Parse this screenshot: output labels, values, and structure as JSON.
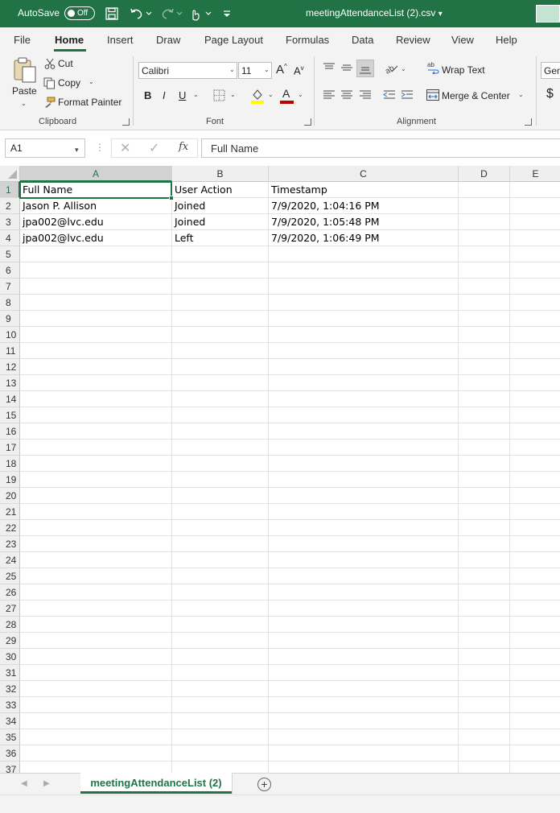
{
  "titlebar": {
    "autosave_label": "AutoSave",
    "autosave_state": "Off",
    "document_title": "meetingAttendanceList (2).csv",
    "title_chevron": "⌄",
    "icons": [
      "save-icon",
      "undo-icon",
      "redo-icon",
      "touch-mode-icon",
      "customize-qat-icon"
    ]
  },
  "ribbon_tabs": [
    "File",
    "Home",
    "Insert",
    "Draw",
    "Page Layout",
    "Formulas",
    "Data",
    "Review",
    "View",
    "Help"
  ],
  "active_tab": "Home",
  "clipboard": {
    "paste_label": "Paste",
    "cut_label": "Cut",
    "copy_label": "Copy",
    "format_painter_label": "Format Painter",
    "group_label": "Clipboard"
  },
  "font": {
    "font_name": "Calibri",
    "font_size": "11",
    "increase_label": "A",
    "decrease_label": "A",
    "bold_label": "B",
    "italic_label": "I",
    "underline_label": "U",
    "font_color_label": "A",
    "group_label": "Font"
  },
  "alignment": {
    "wrap_text_label": "Wrap Text",
    "merge_center_label": "Merge & Center",
    "group_label": "Alignment"
  },
  "number": {
    "format_partial": "Gen",
    "currency_symbol": "$"
  },
  "formula_bar": {
    "name_box": "A1",
    "fx_label": "fx",
    "formula": "Full Name"
  },
  "grid": {
    "columns": [
      "A",
      "B",
      "C",
      "D",
      "E"
    ],
    "row_numbers": [
      "1",
      "2",
      "3",
      "4",
      "5",
      "6",
      "7",
      "8",
      "9",
      "10",
      "11",
      "12",
      "13",
      "14",
      "15",
      "16",
      "17",
      "18",
      "19",
      "20",
      "21",
      "22",
      "23",
      "24",
      "25",
      "26",
      "27",
      "28",
      "29",
      "30",
      "31",
      "32",
      "33",
      "34",
      "35",
      "36",
      "37"
    ],
    "rows": [
      [
        "Full Name",
        "User Action",
        "Timestamp"
      ],
      [
        "Jason P. Allison",
        "Joined",
        "7/9/2020, 1:04:16 PM"
      ],
      [
        "jpa002@lvc.edu",
        "Joined",
        "7/9/2020, 1:05:48 PM"
      ],
      [
        "jpa002@lvc.edu",
        "Left",
        "7/9/2020, 1:06:49 PM"
      ]
    ]
  },
  "sheets": {
    "active_sheet": "meetingAttendanceList (2)",
    "add_label": "+"
  },
  "colors": {
    "accent": "#217346",
    "ribbon_bg": "#f3f3f3",
    "highlight_yellow": "#ffff00",
    "font_red": "#c00000"
  }
}
